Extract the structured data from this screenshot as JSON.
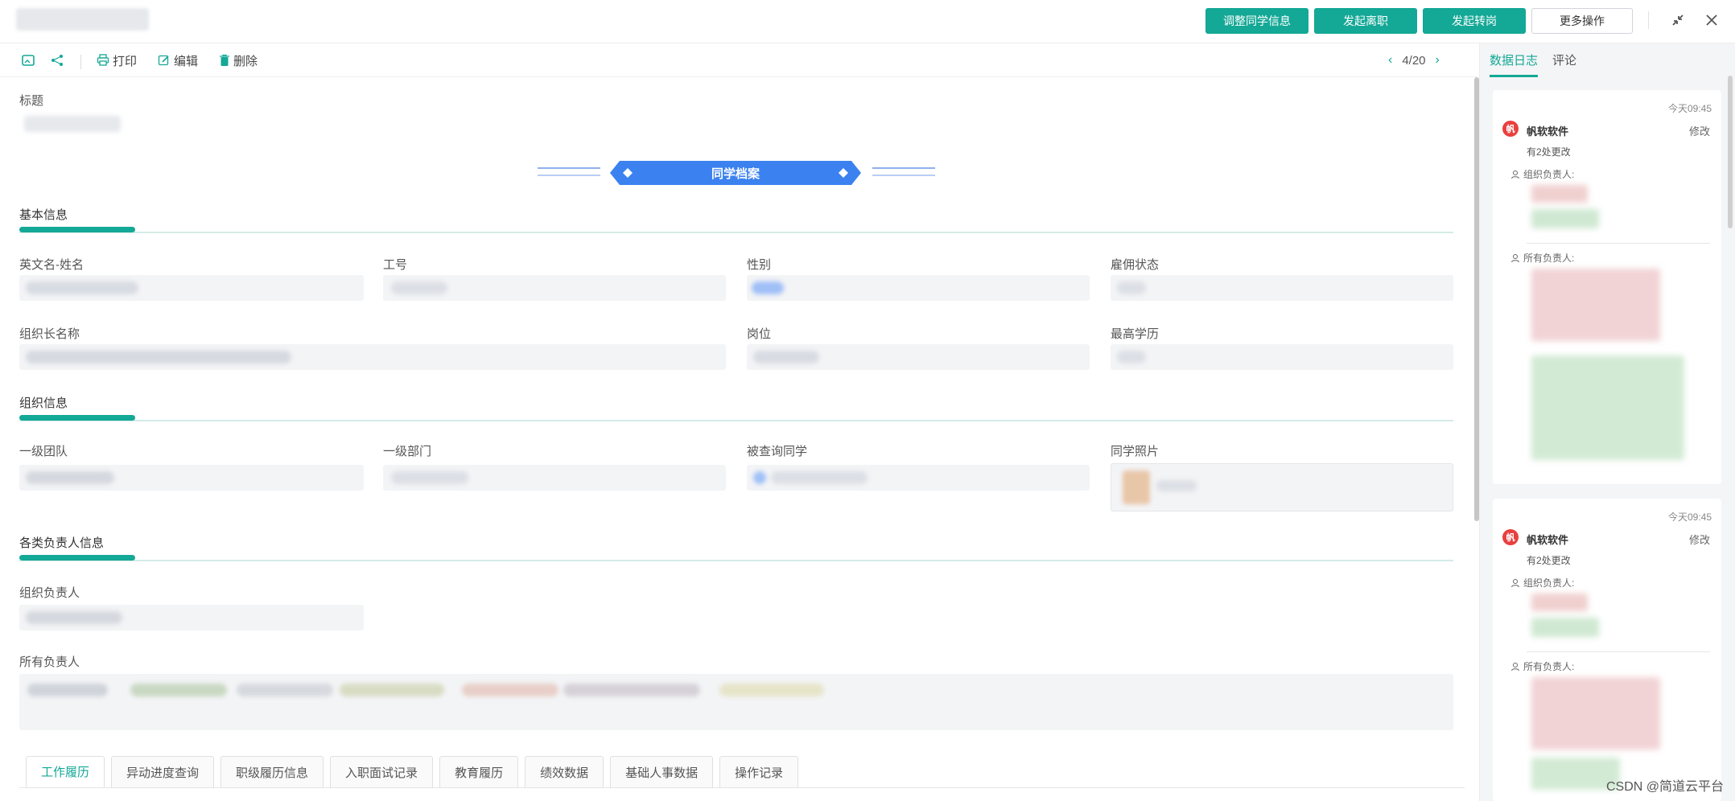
{
  "header": {
    "buttons": {
      "adjust": "调整同学信息",
      "resign": "发起离职",
      "transfer": "发起转岗",
      "more": "更多操作"
    }
  },
  "toolbar": {
    "print": "打印",
    "edit": "编辑",
    "delete": "删除",
    "pager": "4/20"
  },
  "form": {
    "title_label": "标题",
    "banner": "同学档案",
    "sections": {
      "basic": "基本信息",
      "org": "组织信息",
      "owners": "各类负责人信息"
    },
    "fields": {
      "english_name": "英文名-姓名",
      "employee_no": "工号",
      "gender": "性别",
      "employment_status": "雇佣状态",
      "org_full_name": "组织长名称",
      "position": "岗位",
      "education": "最高学历",
      "team_l1": "一级团队",
      "dept_l1": "一级部门",
      "queried_colleague": "被查询同学",
      "photo": "同学照片",
      "org_owner": "组织负责人",
      "all_owners": "所有负责人"
    }
  },
  "bottom_tabs": [
    "工作履历",
    "异动进度查询",
    "职级履历信息",
    "入职面试记录",
    "教育履历",
    "绩效数据",
    "基础人事数据",
    "操作记录"
  ],
  "right_panel": {
    "tabs": [
      "数据日志",
      "评论"
    ],
    "logs": [
      {
        "time": "今天09:45",
        "avatar": "帆",
        "user": "帆软软件",
        "action": "修改",
        "summary": "有2处更改",
        "field1": "组织负责人:",
        "field2": "所有负责人:"
      },
      {
        "time": "今天09:45",
        "avatar": "帆",
        "user": "帆软软件",
        "action": "修改",
        "summary": "有2处更改",
        "field1": "组织负责人:",
        "field2": "所有负责人:"
      }
    ]
  },
  "watermark": "CSDN @简道云平台"
}
